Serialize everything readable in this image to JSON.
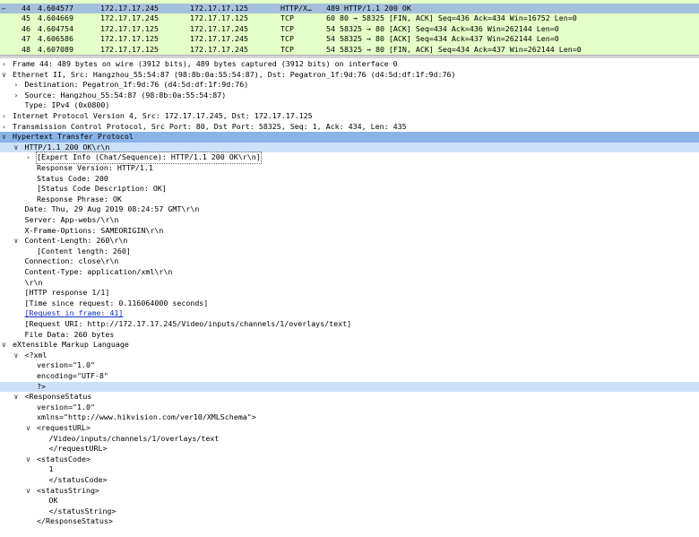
{
  "packet_list": {
    "rows": [
      {
        "no": "44",
        "time": "4.604577",
        "src": "172.17.17.245",
        "dst": "172.17.17.125",
        "proto": "HTTP/X…",
        "info": "489 HTTP/1.1 200 OK",
        "selected": true
      },
      {
        "no": "45",
        "time": "4.604669",
        "src": "172.17.17.245",
        "dst": "172.17.17.125",
        "proto": "TCP",
        "info": "60 80 → 58325 [FIN, ACK] Seq=436 Ack=434 Win=16752 Len=0"
      },
      {
        "no": "46",
        "time": "4.604754",
        "src": "172.17.17.125",
        "dst": "172.17.17.245",
        "proto": "TCP",
        "info": "54 58325 → 80 [ACK] Seq=434 Ack=436 Win=262144 Len=0"
      },
      {
        "no": "47",
        "time": "4.606586",
        "src": "172.17.17.125",
        "dst": "172.17.17.245",
        "proto": "TCP",
        "info": "54 58325 → 80 [ACK] Seq=434 Ack=437 Win=262144 Len=0"
      },
      {
        "no": "48",
        "time": "4.607089",
        "src": "172.17.17.125",
        "dst": "172.17.17.245",
        "proto": "TCP",
        "info": "54 58325 → 80 [FIN, ACK] Seq=434 Ack=437 Win=262144 Len=0"
      }
    ]
  },
  "details": {
    "rows": [
      {
        "indent": 0,
        "exp": ">",
        "text": "Frame 44: 489 bytes on wire (3912 bits), 489 bytes captured (3912 bits) on interface 0"
      },
      {
        "indent": 0,
        "exp": "v",
        "text": "Ethernet II, Src: Hangzhou_55:54:87 (98:8b:0a:55:54:87), Dst: Pegatron_1f:9d:76 (d4:5d:df:1f:9d:76)"
      },
      {
        "indent": 1,
        "exp": ">",
        "text": "Destination: Pegatron_1f:9d:76 (d4:5d:df:1f:9d:76)"
      },
      {
        "indent": 1,
        "exp": ">",
        "text": "Source: Hangzhou_55:54:87 (98:8b:0a:55:54:87)"
      },
      {
        "indent": 1,
        "exp": "",
        "text": "Type: IPv4 (0x0800)"
      },
      {
        "indent": 0,
        "exp": ">",
        "text": "Internet Protocol Version 4, Src: 172.17.17.245, Dst: 172.17.17.125"
      },
      {
        "indent": 0,
        "exp": ">",
        "text": "Transmission Control Protocol, Src Port: 80, Dst Port: 58325, Seq: 1, Ack: 434, Len: 435"
      },
      {
        "indent": 0,
        "exp": "v",
        "text": "Hypertext Transfer Protocol",
        "sel": 1
      },
      {
        "indent": 1,
        "exp": "v",
        "text": "HTTP/1.1 200 OK\\r\\n",
        "sel": 2
      },
      {
        "indent": 2,
        "exp": ">",
        "text": "[Expert Info (Chat/Sequence): HTTP/1.1 200 OK\\r\\n]",
        "boxed": true
      },
      {
        "indent": 2,
        "exp": "",
        "text": "Response Version: HTTP/1.1"
      },
      {
        "indent": 2,
        "exp": "",
        "text": "Status Code: 200"
      },
      {
        "indent": 2,
        "exp": "",
        "text": "[Status Code Description: OK]"
      },
      {
        "indent": 2,
        "exp": "",
        "text": "Response Phrase: OK"
      },
      {
        "indent": 1,
        "exp": "",
        "text": "Date: Thu, 29 Aug 2019 08:24:57 GMT\\r\\n"
      },
      {
        "indent": 1,
        "exp": "",
        "text": "Server: App-webs/\\r\\n"
      },
      {
        "indent": 1,
        "exp": "",
        "text": "X-Frame-Options: SAMEORIGIN\\r\\n"
      },
      {
        "indent": 1,
        "exp": "v",
        "text": "Content-Length: 260\\r\\n"
      },
      {
        "indent": 2,
        "exp": "",
        "text": "[Content length: 260]"
      },
      {
        "indent": 1,
        "exp": "",
        "text": "Connection: close\\r\\n"
      },
      {
        "indent": 1,
        "exp": "",
        "text": "Content-Type: application/xml\\r\\n"
      },
      {
        "indent": 1,
        "exp": "",
        "text": "\\r\\n"
      },
      {
        "indent": 1,
        "exp": "",
        "text": "[HTTP response 1/1]"
      },
      {
        "indent": 1,
        "exp": "",
        "text": "[Time since request: 0.116064000 seconds]"
      },
      {
        "indent": 1,
        "exp": "",
        "text": "[Request in frame: 41]",
        "link": true
      },
      {
        "indent": 1,
        "exp": "",
        "text": "[Request URI: http://172.17.17.245/Video/inputs/channels/1/overlays/text]"
      },
      {
        "indent": 1,
        "exp": "",
        "text": "File Data: 260 bytes"
      },
      {
        "indent": 0,
        "exp": "v",
        "text": "eXtensible Markup Language"
      },
      {
        "indent": 1,
        "exp": "v",
        "text": "<?xml"
      },
      {
        "indent": 2,
        "exp": "",
        "text": "version=\"1.0\""
      },
      {
        "indent": 2,
        "exp": "",
        "text": "encoding=\"UTF-8\""
      },
      {
        "indent": 2,
        "exp": "",
        "text": "?>",
        "sel": 2
      },
      {
        "indent": 1,
        "exp": "v",
        "text": "<ResponseStatus"
      },
      {
        "indent": 2,
        "exp": "",
        "text": "version=\"1.0\""
      },
      {
        "indent": 2,
        "exp": "",
        "text": "xmlns=\"http://www.hikvision.com/ver10/XMLSchema\">"
      },
      {
        "indent": 2,
        "exp": "v",
        "text": "<requestURL>"
      },
      {
        "indent": 3,
        "exp": "",
        "text": "/Video/inputs/channels/1/overlays/text"
      },
      {
        "indent": 3,
        "exp": "",
        "text": "</requestURL>"
      },
      {
        "indent": 2,
        "exp": "v",
        "text": "<statusCode>"
      },
      {
        "indent": 3,
        "exp": "",
        "text": "1"
      },
      {
        "indent": 3,
        "exp": "",
        "text": "</statusCode>"
      },
      {
        "indent": 2,
        "exp": "v",
        "text": "<statusString>"
      },
      {
        "indent": 3,
        "exp": "",
        "text": "OK"
      },
      {
        "indent": 3,
        "exp": "",
        "text": "</statusString>"
      },
      {
        "indent": 2,
        "exp": "",
        "text": "</ResponseStatus>"
      }
    ]
  }
}
